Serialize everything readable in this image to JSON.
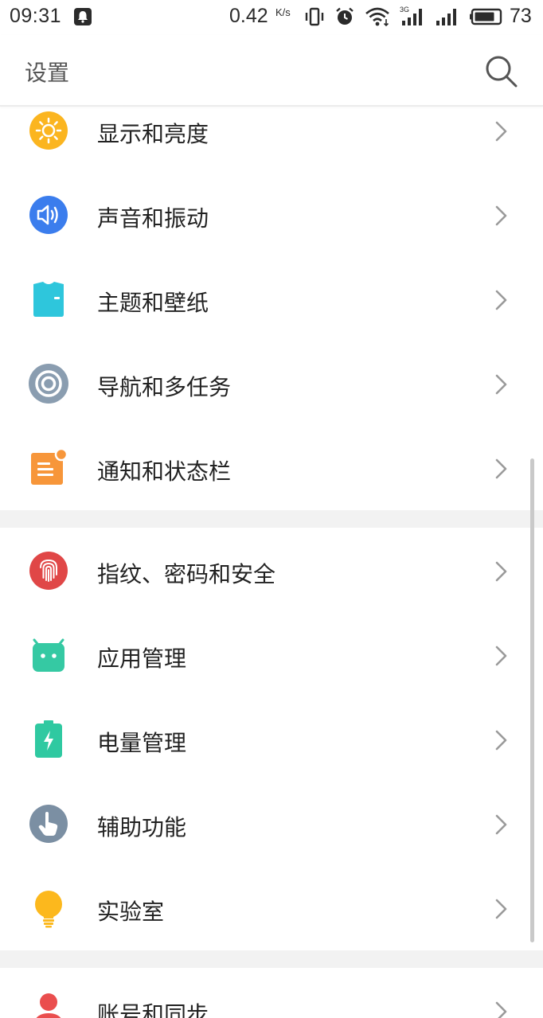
{
  "status_bar": {
    "time": "09:31",
    "net_speed": "0.42",
    "net_speed_unit": "K/s",
    "network_type": "3G",
    "battery": "73",
    "icons": [
      "notification-bell-icon",
      "vibrate-icon",
      "alarm-icon",
      "wifi-icon",
      "signal-3g-icon",
      "signal-icon",
      "battery-icon"
    ]
  },
  "header": {
    "title": "设置",
    "search_icon": "search-icon"
  },
  "colors": {
    "display": "#fbb520",
    "sound": "#3b7ded",
    "theme": "#2ec6dc",
    "navigation": "#8a9db0",
    "notifications": "#f7963a",
    "security": "#e04747",
    "apps": "#35c9a3",
    "battery": "#2fc9a1",
    "accessibility": "#7b8fa3",
    "lab": "#fcb81d",
    "account": "#ea4e4e",
    "chevron": "#9a9a9a",
    "section_gap": "#f2f2f2"
  },
  "sections": [
    {
      "items": [
        {
          "label": "显示和亮度",
          "icon": "brightness-icon"
        },
        {
          "label": "声音和振动",
          "icon": "speaker-icon"
        },
        {
          "label": "主题和壁纸",
          "icon": "tshirt-icon"
        },
        {
          "label": "导航和多任务",
          "icon": "navigation-ring-icon"
        },
        {
          "label": "通知和状态栏",
          "icon": "notification-note-icon"
        }
      ]
    },
    {
      "items": [
        {
          "label": "指纹、密码和安全",
          "icon": "fingerprint-icon"
        },
        {
          "label": "应用管理",
          "icon": "android-robot-icon"
        },
        {
          "label": "电量管理",
          "icon": "battery-charge-icon"
        },
        {
          "label": "辅助功能",
          "icon": "touch-hand-icon"
        },
        {
          "label": "实验室",
          "icon": "lightbulb-icon"
        }
      ]
    },
    {
      "items": [
        {
          "label": "账号和同步",
          "icon": "person-icon"
        }
      ]
    }
  ]
}
